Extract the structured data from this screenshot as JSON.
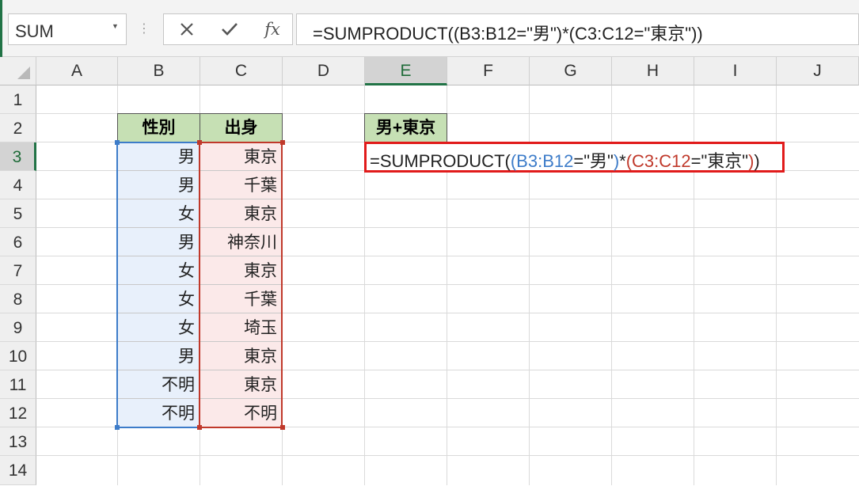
{
  "name_box": {
    "value": "SUM"
  },
  "formula_bar": {
    "cancel_icon": "close-icon",
    "enter_icon": "check-icon",
    "fx_label": "fx",
    "value": "=SUMPRODUCT((B3:B12=\"男\")*(C3:C12=\"東京\"))"
  },
  "columns": [
    "A",
    "B",
    "C",
    "D",
    "E",
    "F",
    "G",
    "H",
    "I",
    "J"
  ],
  "selected_column": "E",
  "rows": [
    "1",
    "2",
    "3",
    "4",
    "5",
    "6",
    "7",
    "8",
    "9",
    "10",
    "11",
    "12",
    "13",
    "14"
  ],
  "selected_row": "3",
  "table": {
    "header_gender": "性別",
    "header_origin": "出身",
    "gender": [
      "男",
      "男",
      "女",
      "男",
      "女",
      "女",
      "女",
      "男",
      "不明",
      "不明"
    ],
    "origin": [
      "東京",
      "千葉",
      "東京",
      "神奈川",
      "東京",
      "千葉",
      "埼玉",
      "東京",
      "東京",
      "不明"
    ]
  },
  "result_header": "男+東京",
  "editing_cell": {
    "part1": "=SUMPRODUCT(",
    "paren_open_1": "(",
    "ref_1": "B3:B12",
    "mid_1": "=\"男\"",
    "paren_close_1": ")",
    "op": "*",
    "paren_open_2": "(",
    "ref_2": "C3:C12",
    "mid_2": "=\"東京\"",
    "paren_close_2": ")",
    "end": ")"
  },
  "colors": {
    "accent": "#217346",
    "ref_blue": "#3d7cc9",
    "ref_red": "#c0392b",
    "edit_border": "#e11b1b",
    "header_fill": "#c6e0b4"
  }
}
